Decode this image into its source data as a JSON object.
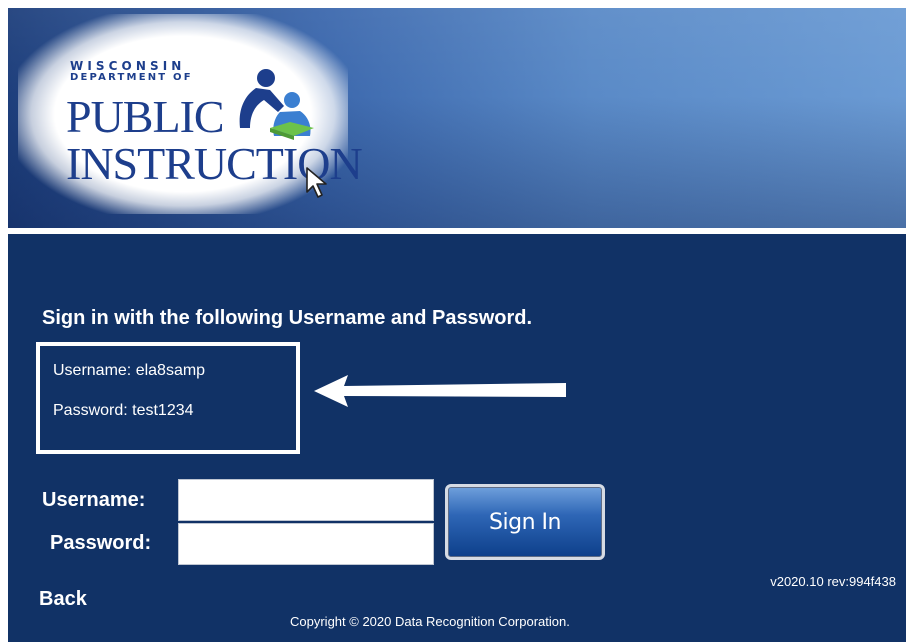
{
  "header": {
    "logo": {
      "line1": "WISCONSIN",
      "line2": "DEPARTMENT OF",
      "line3": "PUBLIC",
      "line4": "INSTRUCTION"
    }
  },
  "colors": {
    "page_bg": "#113266",
    "header_gradient_start": "#1e3f7c",
    "header_gradient_end": "#6b9bd4",
    "logo_text": "#1d3e8c",
    "logo_green": "#6cc24a",
    "text": "#ffffff"
  },
  "icons": {
    "logo": "parent-and-child-reading-icon",
    "pointer": "mouse-cursor-icon",
    "callout": "left-arrow-icon"
  },
  "main": {
    "instruction": "Sign in with the following Username and Password.",
    "credentials": {
      "username_line": "Username: ela8samp",
      "password_line": "Password: test1234"
    },
    "form": {
      "username_label": "Username:",
      "password_label": "Password:",
      "username_value": "",
      "password_value": "",
      "signin_label": "Sign In"
    },
    "version": "v2020.10 rev:994f438",
    "back_label": "Back",
    "copyright": "Copyright © 2020 Data Recognition Corporation."
  }
}
